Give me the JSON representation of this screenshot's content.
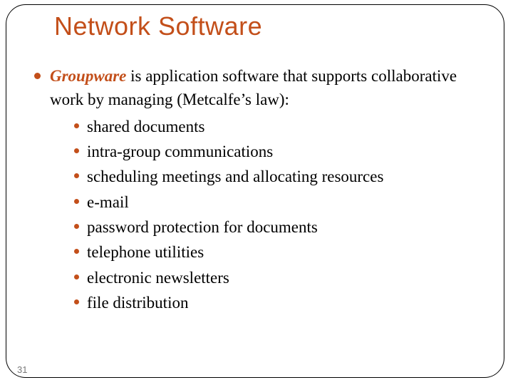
{
  "title": "Network Software",
  "lead_term": "Groupware",
  "lead_rest": " is application software that supports collaborative work by managing (Metcalfe’s law):",
  "items": [
    "shared documents",
    "intra-group communications",
    "scheduling meetings and allocating resources",
    "e-mail",
    "password protection for documents",
    "telephone utilities",
    "electronic newsletters",
    "file distribution"
  ],
  "page_number": "31"
}
